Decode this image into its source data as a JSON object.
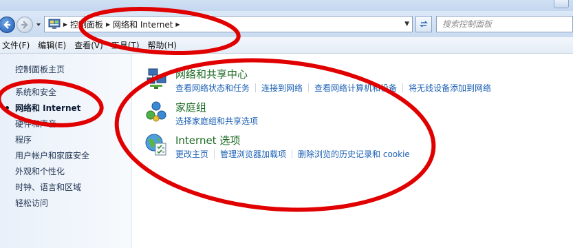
{
  "addressbar": {
    "crumbs": [
      "控制面板",
      "网络和 Internet"
    ],
    "search_placeholder": "搜索控制面板"
  },
  "menu": {
    "items": [
      "文件(F)",
      "编辑(E)",
      "查看(V)",
      "工具(T)",
      "帮助(H)"
    ]
  },
  "sidebar": {
    "items": [
      {
        "label": "控制面板主页",
        "active": false
      },
      {
        "label": "系统和安全",
        "active": false
      },
      {
        "label": "网络和 Internet",
        "active": true
      },
      {
        "label": "硬件和声音",
        "active": false
      },
      {
        "label": "程序",
        "active": false
      },
      {
        "label": "用户帐户和家庭安全",
        "active": false
      },
      {
        "label": "外观和个性化",
        "active": false
      },
      {
        "label": "时钟、语言和区域",
        "active": false
      },
      {
        "label": "轻松访问",
        "active": false
      }
    ]
  },
  "categories": [
    {
      "title": "网络和共享中心",
      "icon": "network-sharing-center-icon",
      "links": [
        "查看网络状态和任务",
        "连接到网络",
        "查看网络计算机和设备",
        "将无线设备添加到网络"
      ]
    },
    {
      "title": "家庭组",
      "icon": "homegroup-icon",
      "links": [
        "选择家庭组和共享选项"
      ]
    },
    {
      "title": "Internet 选项",
      "icon": "internet-options-icon",
      "links": [
        "更改主页",
        "管理浏览器加载项",
        "删除浏览的历史记录和 cookie"
      ]
    }
  ],
  "colors": {
    "category_title": "#1c6a23",
    "link": "#1a5fb4",
    "annotation_ring": "#e00000",
    "sidebar_bg": "#e9f0f9"
  }
}
